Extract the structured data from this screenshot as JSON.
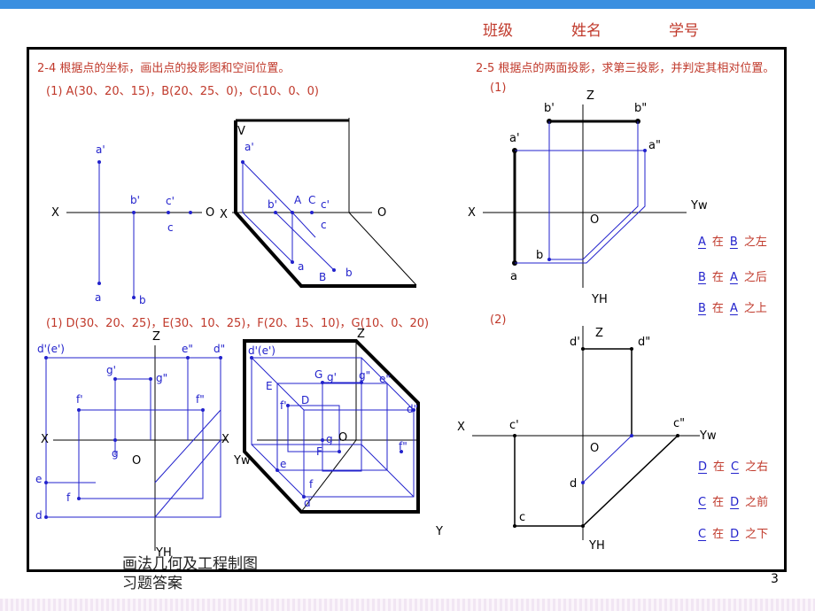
{
  "header": {
    "class_label": "班级",
    "name_label": "姓名",
    "id_label": "学号"
  },
  "problems": {
    "p24_title": "2-4  根据点的坐标，画出点的投影图和空间位置。",
    "p24_q1": "(1) A(30、20、15)，B(20、25、0)，C(10、0、0)",
    "p24_q2": "(1) D(30、20、25)，E(30、10、25)，F(20、15、10)，G(10、0、20)",
    "p25_title": "2-5  根据点的两面投影，求第三投影，并判定其相对位置。",
    "p25_q1": "(1)",
    "p25_q2": "(2)"
  },
  "answers1": [
    {
      "a": "A",
      "mid": "在",
      "b": "B",
      "rel": "之左"
    },
    {
      "a": "B",
      "mid": "在",
      "b": "A",
      "rel": "之后"
    },
    {
      "a": "B",
      "mid": "在",
      "b": "A",
      "rel": "之上"
    }
  ],
  "answers2": [
    {
      "a": "D",
      "mid": "在",
      "b": "C",
      "rel": "之右"
    },
    {
      "a": "C",
      "mid": "在",
      "b": "D",
      "rel": "之前"
    },
    {
      "a": "C",
      "mid": "在",
      "b": "D",
      "rel": "之下"
    }
  ],
  "labels": {
    "X": "X",
    "O": "O",
    "Z": "Z",
    "V": "V",
    "Y": "Y",
    "YW": "Yw",
    "YH": "YH",
    "a1": "a'",
    "a": "a",
    "b1": "b'",
    "b": "b",
    "c1": "c'",
    "c": "c",
    "A": "A",
    "B": "B",
    "C": "C",
    "b2": "b\"",
    "a2": "a\"",
    "c2": "c\"",
    "d1": "d'",
    "d2": "d\"",
    "d": "d",
    "de1": "d'(e')",
    "e2": "e\"",
    "e": "e",
    "f1": "f'",
    "f2": "f\"",
    "f": "f",
    "g1": "g'",
    "g2": "g\"",
    "g": "g",
    "D": "D",
    "E": "E",
    "F": "F",
    "G": "G"
  },
  "footer": {
    "line1": "画法几何及工程制图",
    "line2": "习题答案"
  },
  "page_number": "3",
  "colors": {
    "title_red": "#c0392b",
    "drawing_blue": "#2222cc",
    "top_bar": "#3a8fe0"
  }
}
